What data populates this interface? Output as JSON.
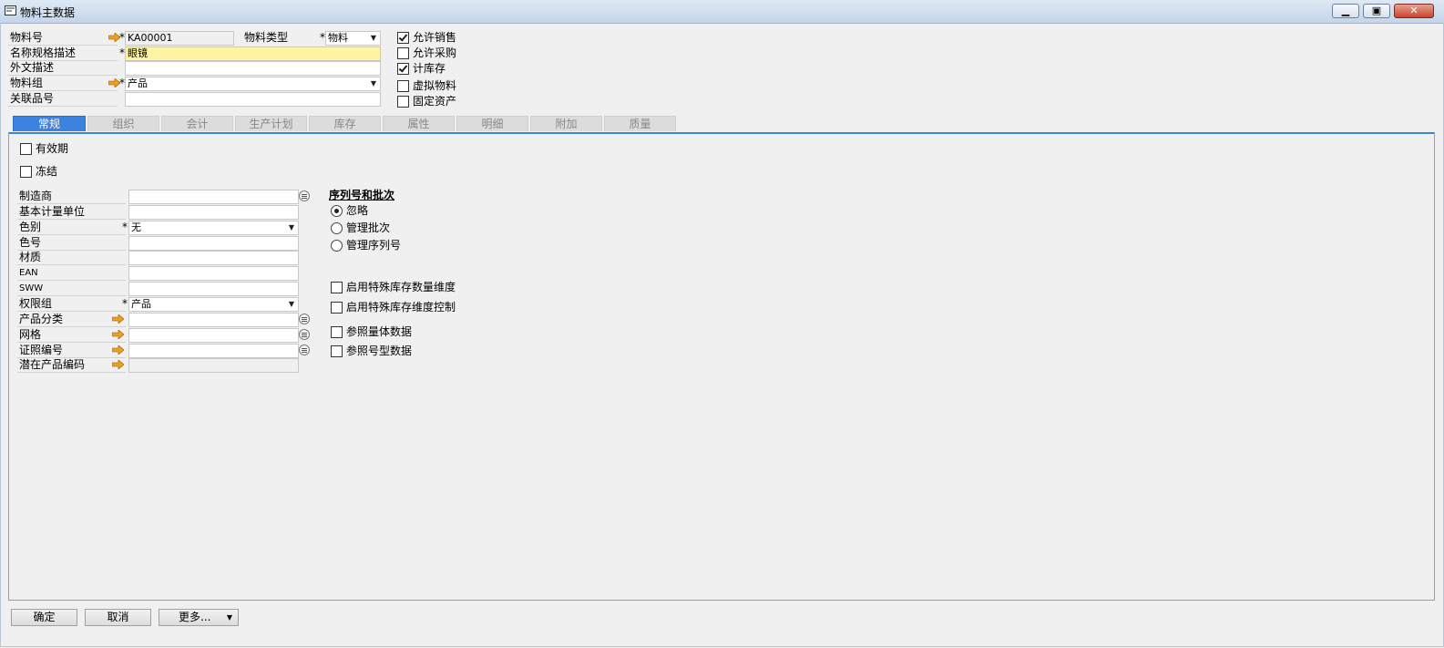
{
  "window": {
    "title": "物料主数据",
    "minimize_icon": "minimize-icon",
    "maximize_icon": "restore-icon",
    "close_icon": "close-icon"
  },
  "header": {
    "item_no_label": "物料号",
    "item_no_value": "KA00001",
    "item_type_label": "物料类型",
    "item_type_value": "物料",
    "desc_label": "名称规格描述",
    "desc_value": "眼镜",
    "foreign_desc_label": "外文描述",
    "foreign_desc_value": "",
    "item_group_label": "物料组",
    "item_group_value": "产品",
    "related_item_label": "关联品号",
    "related_item_value": "",
    "checkboxes": [
      {
        "label": "允许销售",
        "checked": true
      },
      {
        "label": "允许采购",
        "checked": false
      },
      {
        "label": "计库存",
        "checked": true
      },
      {
        "label": "虚拟物料",
        "checked": false
      },
      {
        "label": "固定资产",
        "checked": false
      }
    ]
  },
  "tabs": [
    "常规",
    "组织",
    "会计",
    "生产计划",
    "库存",
    "属性",
    "明细",
    "附加",
    "质量"
  ],
  "general": {
    "valid_period_label": "有效期",
    "frozen_label": "冻结",
    "manufacturer_label": "制造商",
    "base_uom_label": "基本计量单位",
    "color_label": "色别",
    "color_value": "无",
    "color_no_label": "色号",
    "material_label": "材质",
    "ean_label": "EAN",
    "sww_label": "SWW",
    "permission_label": "权限组",
    "permission_value": "产品",
    "product_category_label": "产品分类",
    "spec_label": "网格",
    "license_label": "证照编号",
    "potential_code_label": "潜在产品编码",
    "serial_title": "序列号和批次",
    "radios": [
      {
        "label": "忽略",
        "selected": true
      },
      {
        "label": "管理批次",
        "selected": false
      },
      {
        "label": "管理序列号",
        "selected": false
      }
    ],
    "options": [
      {
        "label": "启用特殊库存数量维度"
      },
      {
        "label": "启用特殊库存维度控制"
      },
      {
        "label": "参照量体数据"
      },
      {
        "label": "参照号型数据"
      }
    ]
  },
  "footer": {
    "ok": "确定",
    "cancel": "取消",
    "more": "更多..."
  },
  "colors": {
    "tab_active": "#3c82e0",
    "required_highlight": "#fff4a4",
    "link_arrow": "#f0a020"
  }
}
